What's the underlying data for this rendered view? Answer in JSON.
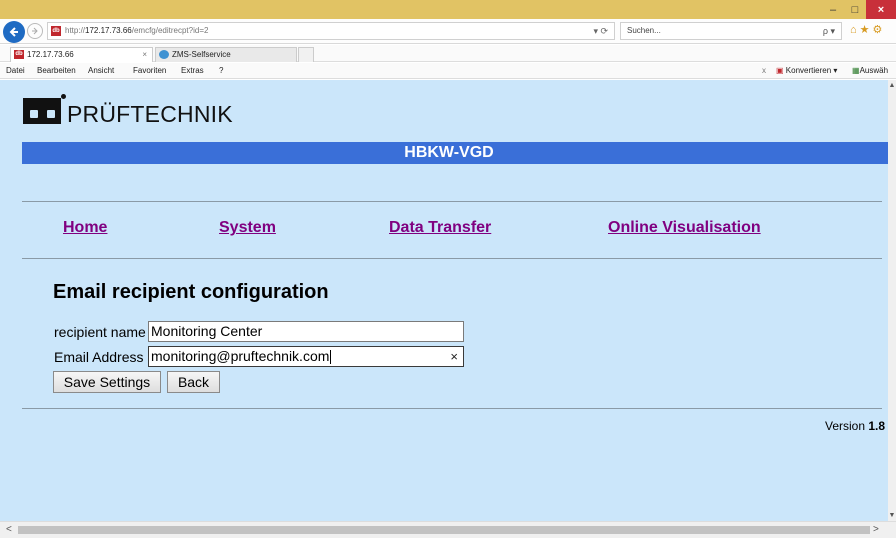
{
  "browser": {
    "url_prefix": "http://",
    "url_host": "172.17.73.66",
    "url_path": "/emcfg/editrecpt?id=2",
    "url_tools": "▾ ⟳",
    "search_placeholder": "Suchen...",
    "search_tools": "ρ ▾",
    "window_minimize": "–",
    "window_maximize": "□",
    "window_close": "×",
    "tabs": [
      {
        "label": "172.17.73.66",
        "active": true
      },
      {
        "label": "ZMS-Selfservice",
        "active": false
      }
    ],
    "favicon_text": "db",
    "menu": [
      "Datei",
      "Bearbeiten",
      "Ansicht",
      "Favoriten",
      "Extras",
      "?"
    ],
    "toolbar_close": "x",
    "toolbar_convert": "Konvertieren",
    "toolbar_select": "Auswäh"
  },
  "page": {
    "brand": "PRÜFTECHNIK",
    "device_name": "HBKW-VGD",
    "nav": [
      "Home",
      "System",
      "Data Transfer",
      "Online Visualisation"
    ],
    "heading": "Email recipient configuration",
    "form": {
      "recipient_name_label": "recipient name",
      "recipient_name_value": "Monitoring Center",
      "email_label": "Email Address",
      "email_value": "monitoring@pruftechnik.com",
      "clear_symbol": "×"
    },
    "buttons": {
      "save": "Save Settings",
      "back": "Back"
    },
    "version_label": "Version",
    "version_value": "1.8"
  },
  "colors": {
    "page_background": "#cbe6fa",
    "device_bar": "#3a6fd8",
    "nav_link": "#800080",
    "title_bar": "#e1c364"
  }
}
